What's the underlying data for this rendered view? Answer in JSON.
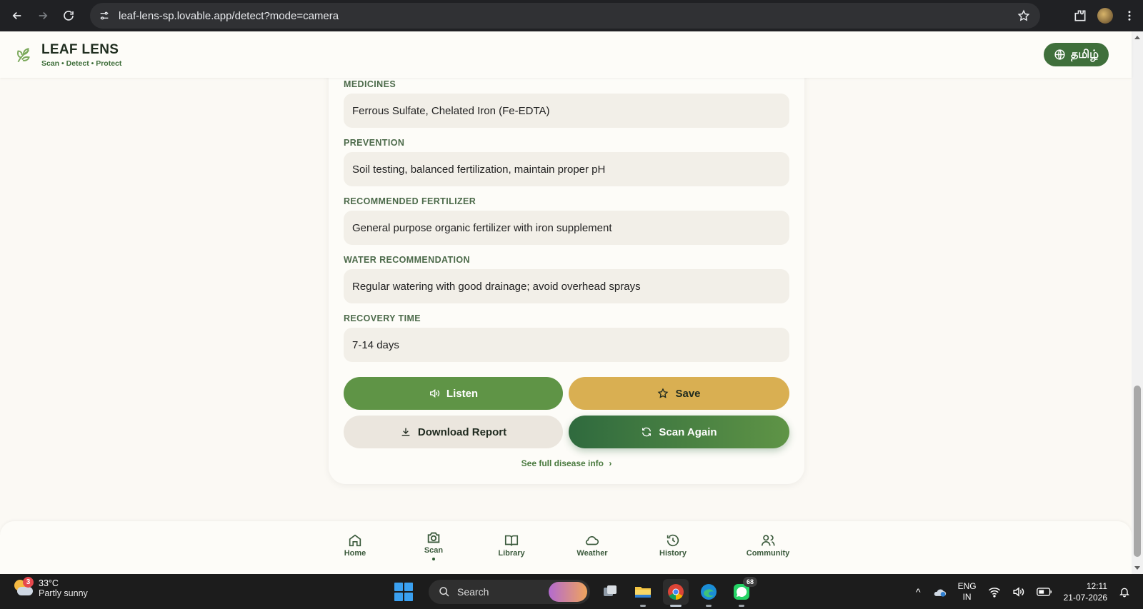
{
  "browser": {
    "url": "leaf-lens-sp.lovable.app/detect?mode=camera"
  },
  "app": {
    "title": "LEAF LENS",
    "tagline": "Scan • Detect • Protect",
    "language_button": "தமிழ்"
  },
  "sections": [
    {
      "label": "MEDICINES",
      "value": "Ferrous Sulfate, Chelated Iron (Fe-EDTA)"
    },
    {
      "label": "PREVENTION",
      "value": "Soil testing, balanced fertilization, maintain proper pH"
    },
    {
      "label": "RECOMMENDED FERTILIZER",
      "value": "General purpose organic fertilizer with iron supplement"
    },
    {
      "label": "WATER RECOMMENDATION",
      "value": "Regular watering with good drainage; avoid overhead sprays"
    },
    {
      "label": "RECOVERY TIME",
      "value": "7-14 days"
    }
  ],
  "actions": {
    "listen": "Listen",
    "save": "Save",
    "download": "Download Report",
    "scan_again": "Scan Again",
    "full_info": "See full disease info"
  },
  "bottom_nav": {
    "items": [
      {
        "label": "Home",
        "icon": "home-icon"
      },
      {
        "label": "Scan",
        "icon": "camera-icon",
        "active": true
      },
      {
        "label": "Library",
        "icon": "book-icon"
      },
      {
        "label": "Weather",
        "icon": "cloud-icon"
      },
      {
        "label": "History",
        "icon": "history-icon"
      },
      {
        "label": "Community",
        "icon": "users-icon"
      }
    ]
  },
  "taskbar": {
    "weather_badge": "3",
    "temperature": "33°C",
    "weather_desc": "Partly sunny",
    "search_label": "Search",
    "whatsapp_badge": "68",
    "lang_top": "ENG",
    "lang_bottom": "IN",
    "time": "12:11",
    "date": "21-07-2026"
  },
  "colors": {
    "primary_green": "#5f9446",
    "dark_green": "#2f6a3e",
    "save_gold": "#d9af52",
    "background": "#fbf9f4"
  }
}
